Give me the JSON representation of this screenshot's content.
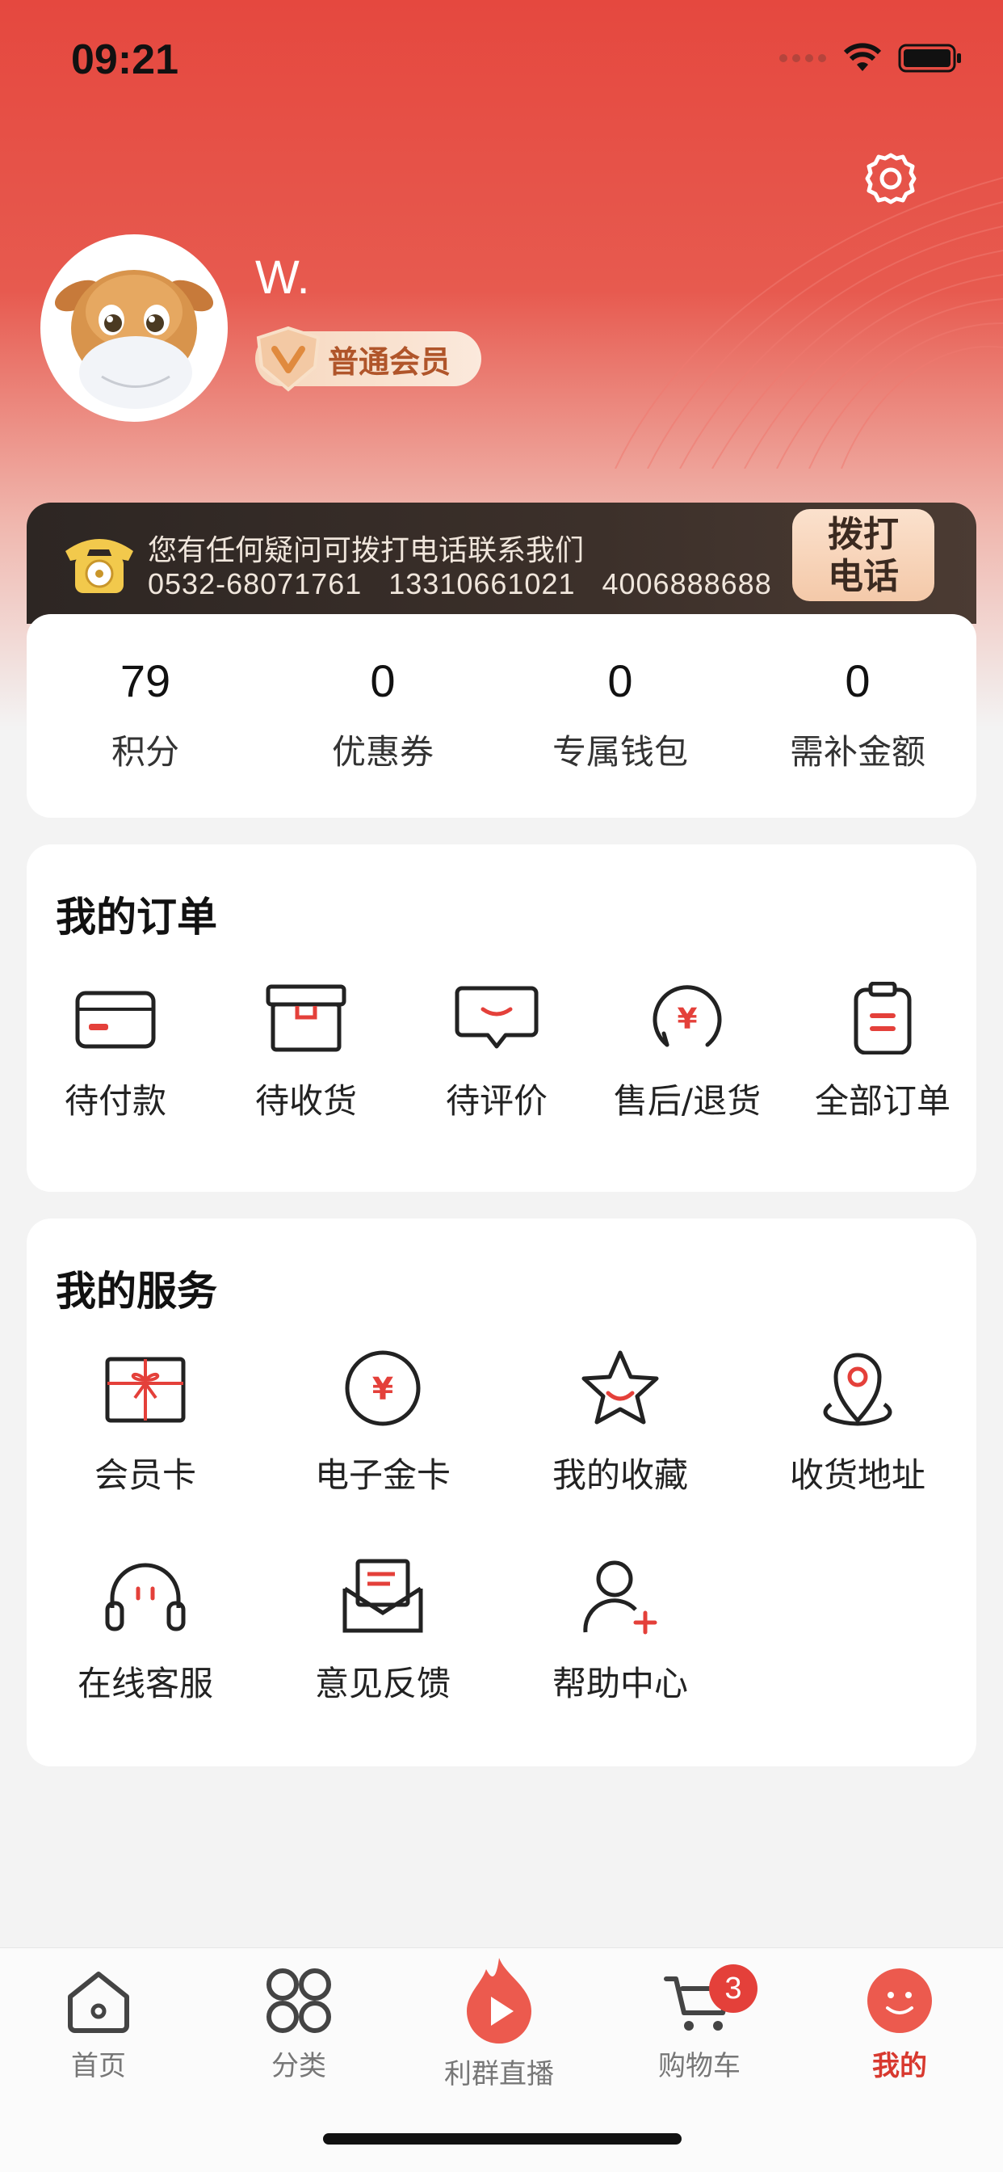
{
  "status_bar": {
    "time": "09:21"
  },
  "profile": {
    "username": "W.",
    "member_level": "普通会员"
  },
  "hotline": {
    "message": "您有任何疑问可拨打电话联系我们",
    "numbers": "0532-68071761   13310661021   4006888688",
    "call_button": [
      "拨打",
      "电话"
    ]
  },
  "stats": [
    {
      "value": "79",
      "label": "积分"
    },
    {
      "value": "0",
      "label": "优惠券"
    },
    {
      "value": "0",
      "label": "专属钱包"
    },
    {
      "value": "0",
      "label": "需补金额"
    }
  ],
  "orders": {
    "title": "我的订单",
    "items": [
      {
        "label": "待付款",
        "icon": "card-icon"
      },
      {
        "label": "待收货",
        "icon": "box-icon"
      },
      {
        "label": "待评价",
        "icon": "comment-icon"
      },
      {
        "label": "售后/退货",
        "icon": "refund-icon"
      },
      {
        "label": "全部订单",
        "icon": "clipboard-icon"
      }
    ]
  },
  "services": {
    "title": "我的服务",
    "items": [
      {
        "label": "会员卡",
        "icon": "gift-card-icon"
      },
      {
        "label": "电子金卡",
        "icon": "yuan-coin-icon"
      },
      {
        "label": "我的收藏",
        "icon": "star-icon"
      },
      {
        "label": "收货地址",
        "icon": "location-pin-icon"
      },
      {
        "label": "在线客服",
        "icon": "headset-icon"
      },
      {
        "label": "意见反馈",
        "icon": "envelope-icon"
      },
      {
        "label": "帮助中心",
        "icon": "user-add-icon"
      }
    ]
  },
  "tabbar": {
    "items": [
      {
        "label": "首页",
        "icon": "home-icon"
      },
      {
        "label": "分类",
        "icon": "grid-icon"
      },
      {
        "label": "利群直播",
        "icon": "live-flame-icon"
      },
      {
        "label": "购物车",
        "icon": "cart-icon",
        "badge": "3"
      },
      {
        "label": "我的",
        "icon": "smile-icon",
        "active": true
      }
    ]
  },
  "colors": {
    "brand_red": "#e5483f",
    "active_tab": "#d8392f",
    "badge": "#e4403a"
  }
}
